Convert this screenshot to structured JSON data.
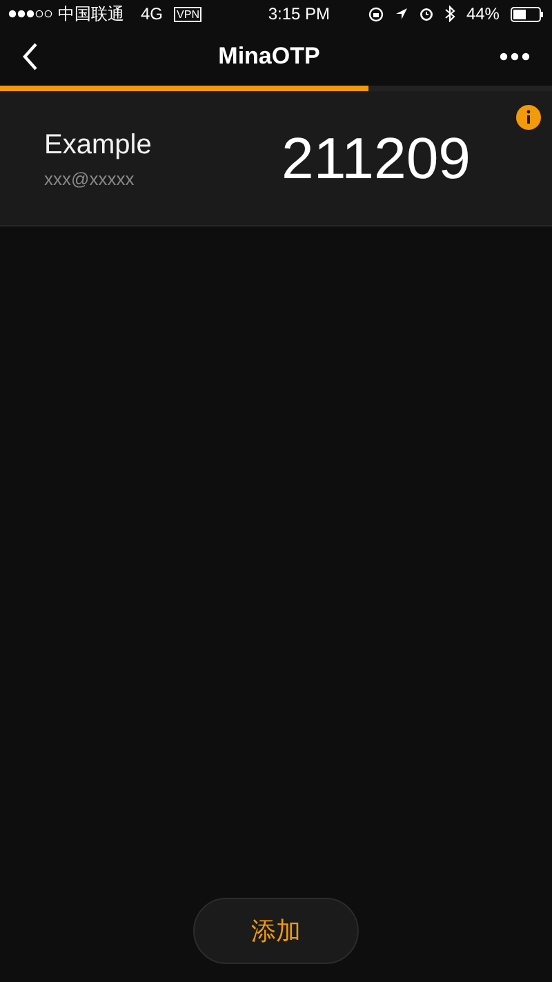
{
  "status_bar": {
    "carrier": "中国联通",
    "network": "4G",
    "vpn": "VPN",
    "time": "3:15 PM",
    "battery": "44%"
  },
  "nav": {
    "title": "MinaOTP"
  },
  "timer": {
    "level": 0.667
  },
  "accounts": [
    {
      "name": "Example",
      "account": "xxx@xxxxx",
      "code": "211209"
    }
  ],
  "add_button": {
    "label": "添加"
  }
}
